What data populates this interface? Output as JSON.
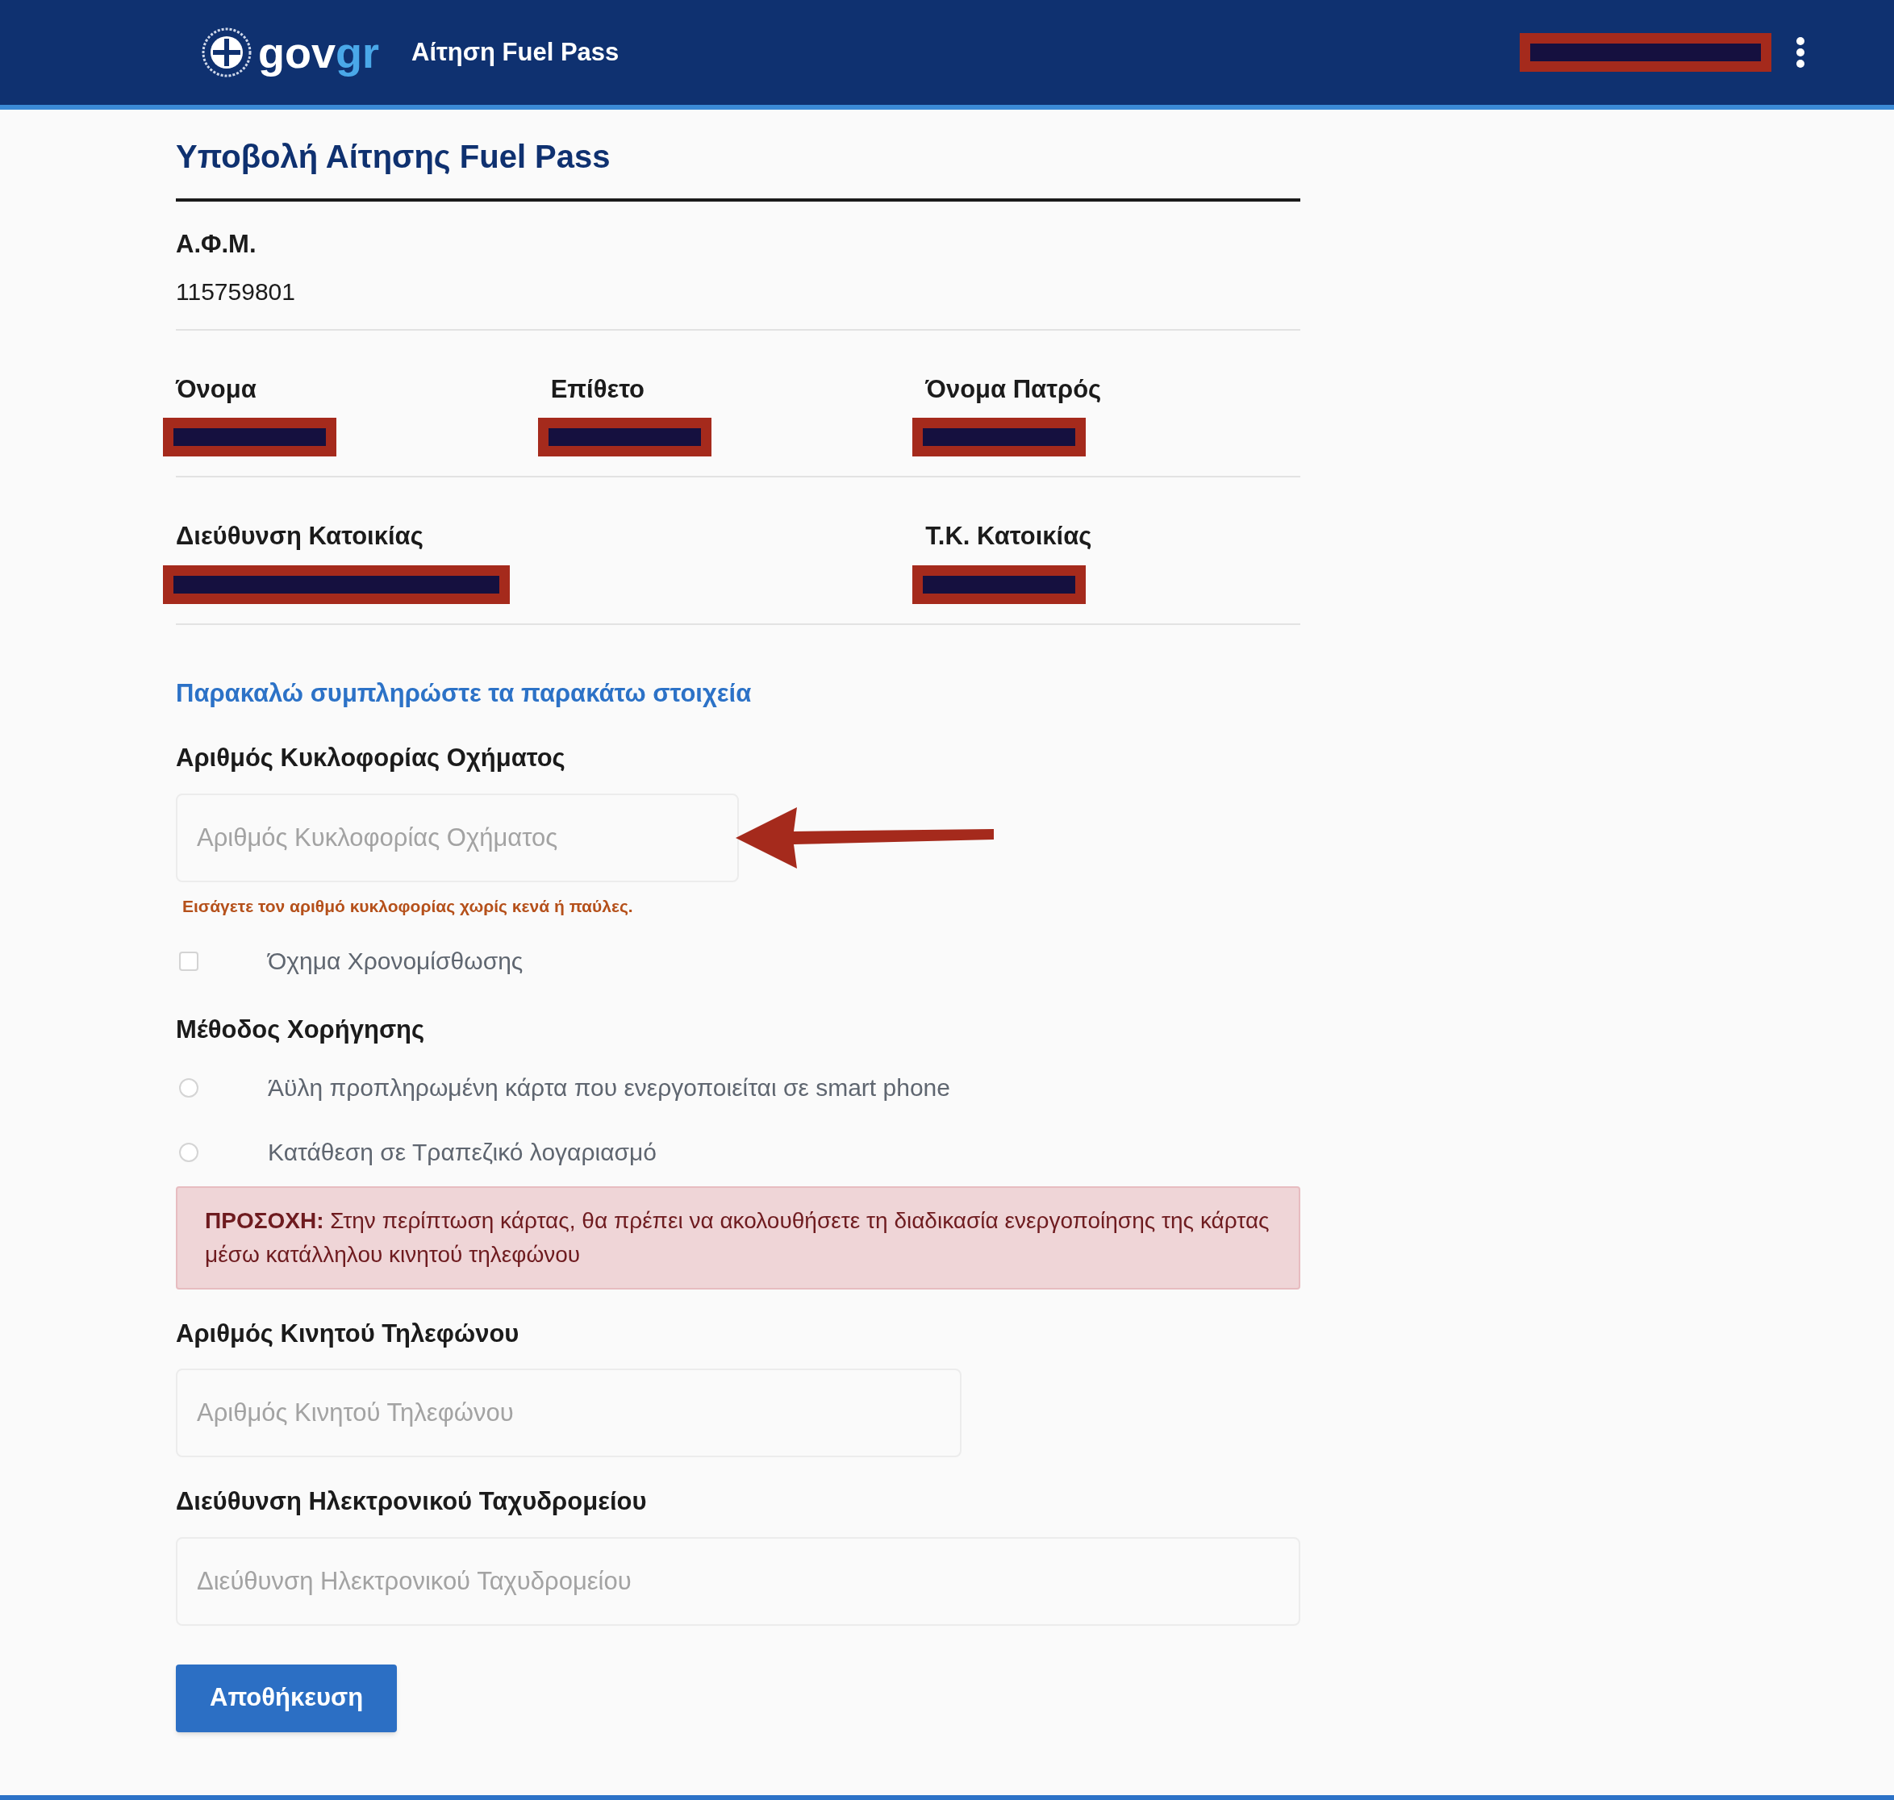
{
  "header": {
    "logo": {
      "part_1": "gov",
      "part_2": "gr"
    },
    "app_title": "Αίτηση Fuel Pass"
  },
  "page_title": "Υποβολή Αίτησης Fuel Pass",
  "afm": {
    "label": "Α.Φ.Μ.",
    "value": "115759801"
  },
  "personal_rows": [
    [
      {
        "label": "Όνομα"
      },
      {
        "label": "Επίθετο"
      },
      {
        "label": "Όνομα Πατρός"
      }
    ],
    [
      {
        "label": "Διεύθυνση Κατοικίας"
      },
      {
        "label": "Τ.Κ. Κατοικίας"
      }
    ]
  ],
  "instructions": "Παρακαλώ συμπληρώστε τα παρακάτω στοιχεία",
  "plate": {
    "label": "Αριθμός Κυκλοφορίας Οχήματος",
    "placeholder": "Αριθμός Κυκλοφορίας Οχήματος",
    "hint": "Εισάγετε τον αριθμό κυκλοφορίας χωρίς κενά ή παύλες."
  },
  "taxi": {
    "label": "Όχημα Χρονομίσθωσης",
    "checked": false
  },
  "method": {
    "label": "Μέθοδος Χορήγησης",
    "options": [
      {
        "label": "Άϋλη προπληρωμένη κάρτα που ενεργοποιείται σε smart phone",
        "selected": false
      },
      {
        "label": "Κατάθεση σε Τραπεζικό λογαριασμό",
        "selected": false
      }
    ]
  },
  "alert": "**ΠΡΟΣΟΧΗ:** Στην περίπτωση κάρτας, θα πρέπει να ακολουθήσετε τη διαδικασία ενεργοποίησης της κάρτας μέσω κατάλληλου κινητού τηλεφώνου",
  "phone": {
    "label": "Αριθμός Κινητού Τηλεφώνου",
    "placeholder": "Αριθμός Κινητού Τηλεφώνου"
  },
  "email": {
    "label": "Διεύθυνση Ηλεκτρονικού Ταχυδρομείου",
    "placeholder": "Διεύθυνση Ηλεκτρονικού Ταχυδρομείου"
  },
  "submit": "Αποθήκευση"
}
